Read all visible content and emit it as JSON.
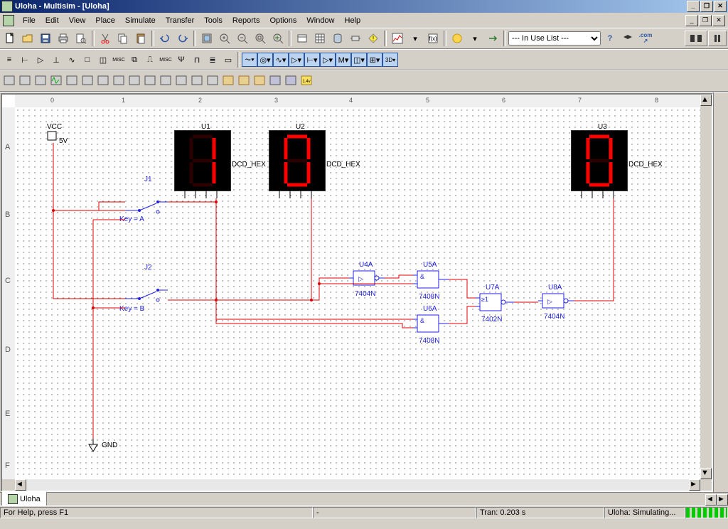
{
  "title": "Uloha - Multisim - [Uloha]",
  "menu": {
    "file": "File",
    "edit": "Edit",
    "view": "View",
    "place": "Place",
    "simulate": "Simulate",
    "transfer": "Transfer",
    "tools": "Tools",
    "reports": "Reports",
    "options": "Options",
    "window": "Window",
    "help": "Help"
  },
  "inUseList": "--- In Use List ---",
  "ruler_cols": [
    "0",
    "1",
    "2",
    "3",
    "4",
    "5",
    "6",
    "7",
    "8"
  ],
  "ruler_rows": [
    "A",
    "B",
    "C",
    "D",
    "E",
    "F"
  ],
  "components": {
    "vcc": {
      "label": "VCC",
      "voltage": "5V"
    },
    "gnd": {
      "label": "GND"
    },
    "j1": {
      "name": "J1",
      "key": "Key = A"
    },
    "j2": {
      "name": "J2",
      "key": "Key = B"
    },
    "u1": {
      "name": "U1",
      "type": "DCD_HEX"
    },
    "u2": {
      "name": "U2",
      "type": "DCD_HEX"
    },
    "u3": {
      "name": "U3",
      "type": "DCD_HEX"
    },
    "u4": {
      "name": "U4A",
      "type": "7404N"
    },
    "u5": {
      "name": "U5A",
      "type": "7408N"
    },
    "u6": {
      "name": "U6A",
      "type": "7408N"
    },
    "u7": {
      "name": "U7A",
      "type": "7402N"
    },
    "u8": {
      "name": "U8A",
      "type": "7404N"
    }
  },
  "tab": "Uloha",
  "status": {
    "help": "For Help, press F1",
    "coord": "-",
    "sim": "Tran: 0.203 s",
    "right": "Uloha: Simulating..."
  }
}
